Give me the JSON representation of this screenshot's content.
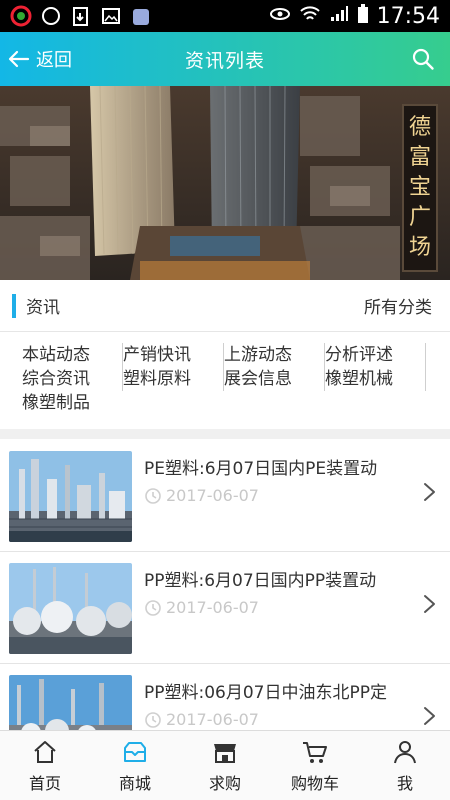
{
  "statusbar": {
    "time": "17:54"
  },
  "header": {
    "back_label": "返回",
    "title": "资讯列表"
  },
  "banner": {
    "sign_text": [
      "德",
      "富",
      "宝",
      "广",
      "场"
    ]
  },
  "section": {
    "title": "资讯",
    "all_label": "所有分类"
  },
  "categories": [
    "本站动态",
    "产销快讯",
    "上游动态",
    "分析评述",
    "综合资讯",
    "塑料原料",
    "展会信息",
    "橡塑机械",
    "橡塑制品"
  ],
  "news": [
    {
      "title": "PE塑料:6月07日国内PE装置动",
      "date": "2017-06-07"
    },
    {
      "title": "PP塑料:6月07日国内PP装置动",
      "date": "2017-06-07"
    },
    {
      "title": "PP塑料:06月07日中油东北PP定",
      "date": "2017-06-07"
    }
  ],
  "bottom_nav": [
    {
      "label": "首页",
      "icon": "home-icon"
    },
    {
      "label": "商城",
      "icon": "mall-icon"
    },
    {
      "label": "求购",
      "icon": "store-icon"
    },
    {
      "label": "购物车",
      "icon": "cart-icon"
    },
    {
      "label": "我",
      "icon": "user-icon"
    }
  ],
  "colors": {
    "header_start": "#13b7e6",
    "header_end": "#36cd8e",
    "accent": "#1faee8",
    "active_nav": "#1faee8"
  }
}
